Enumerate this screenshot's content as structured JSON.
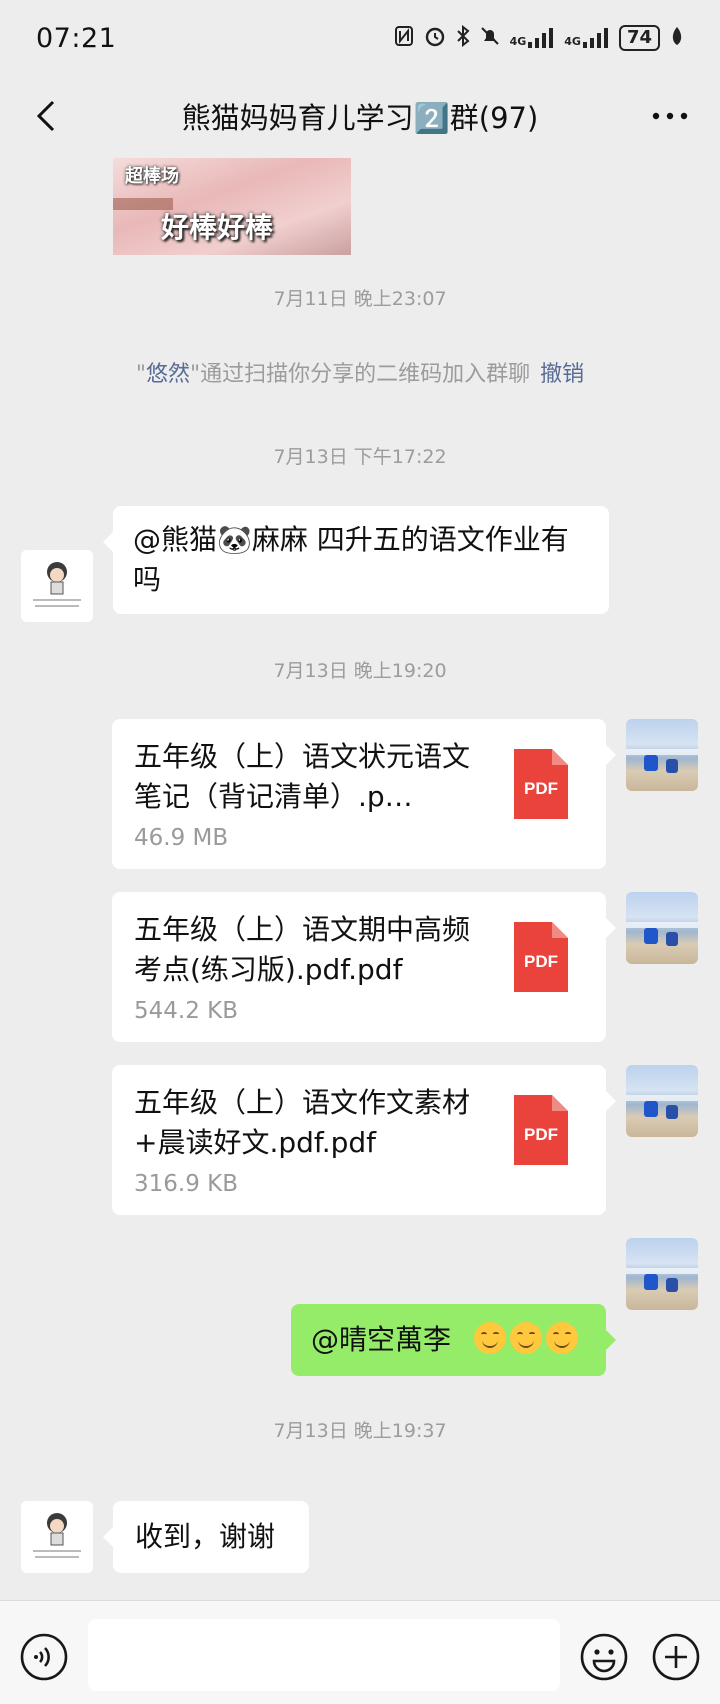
{
  "status_bar": {
    "time": "07:21",
    "network_1": "4G",
    "network_2": "4G",
    "battery": "74"
  },
  "header": {
    "title": "熊猫妈妈育儿学习2️⃣群(97)"
  },
  "sticker": {
    "top_text": "超棒场",
    "bottom_text": "好棒好棒"
  },
  "messages": {
    "ts1": "7月11日 晚上23:07",
    "system": {
      "quote_open": "\"",
      "name": "悠然",
      "rest": "\"通过扫描你分享的二维码加入群聊",
      "revoke": "撤销"
    },
    "ts2": "7月13日 下午17:22",
    "msg1": "@熊猫🐼麻麻  四升五的语文作业有吗",
    "ts3": "7月13日 晚上19:20",
    "files": [
      {
        "name": "五年级（上）语文状元语文笔记（背记清单）.p…",
        "size": "46.9 MB",
        "icon": "PDF"
      },
      {
        "name": "五年级（上）语文期中高频考点(练习版).pdf.pdf",
        "size": "544.2 KB",
        "icon": "PDF"
      },
      {
        "name": "五年级（上）语文作文素材+晨读好文.pdf.pdf",
        "size": "316.9 KB",
        "icon": "PDF"
      }
    ],
    "msg2": "@晴空萬李",
    "ts4": "7月13日 晚上19:37",
    "msg3": "收到，谢谢"
  },
  "colors": {
    "background": "#EDEDED",
    "green_bubble": "#95EC69",
    "link": "#576B95",
    "pdf_red": "#E9433B"
  }
}
